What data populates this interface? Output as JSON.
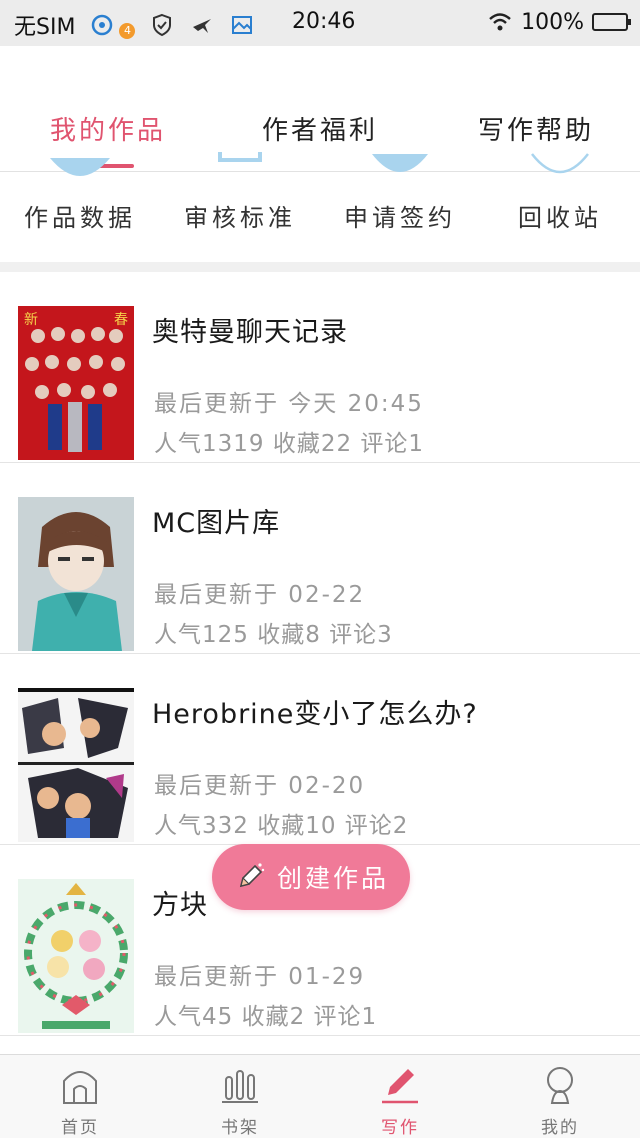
{
  "status_bar": {
    "carrier": "无SIM",
    "notification_count": "4",
    "time": "20:46",
    "battery": "100%"
  },
  "tabs": [
    {
      "label": "我的作品",
      "active": true
    },
    {
      "label": "作者福利",
      "active": false
    },
    {
      "label": "写作帮助",
      "active": false
    }
  ],
  "shortcuts": [
    {
      "label": "作品数据"
    },
    {
      "label": "审核标准"
    },
    {
      "label": "申请签约"
    },
    {
      "label": "回收站"
    }
  ],
  "works": [
    {
      "title": "奥特曼聊天记录",
      "updated": "最后更新于 今天 20:45",
      "stats": "人气1319 收藏22 评论1"
    },
    {
      "title": "MC图片库",
      "updated": "最后更新于 02-22",
      "stats": "人气125 收藏8 评论3"
    },
    {
      "title": "Herobrine变小了怎么办?",
      "updated": "最后更新于 02-20",
      "stats": "人气332 收藏10 评论2"
    },
    {
      "title": "方块",
      "updated": "最后更新于 01-29",
      "stats": "人气45 收藏2 评论1"
    }
  ],
  "fab": {
    "label": "创建作品"
  },
  "bottom_nav": [
    {
      "label": "首页",
      "icon": "home-icon"
    },
    {
      "label": "书架",
      "icon": "bookshelf-icon"
    },
    {
      "label": "写作",
      "icon": "pen-icon",
      "active": true
    },
    {
      "label": "我的",
      "icon": "profile-icon"
    }
  ],
  "colors": {
    "accent": "#e0546f",
    "fab": "#f07a98",
    "shortcut_arc": "#a9d4ee"
  }
}
